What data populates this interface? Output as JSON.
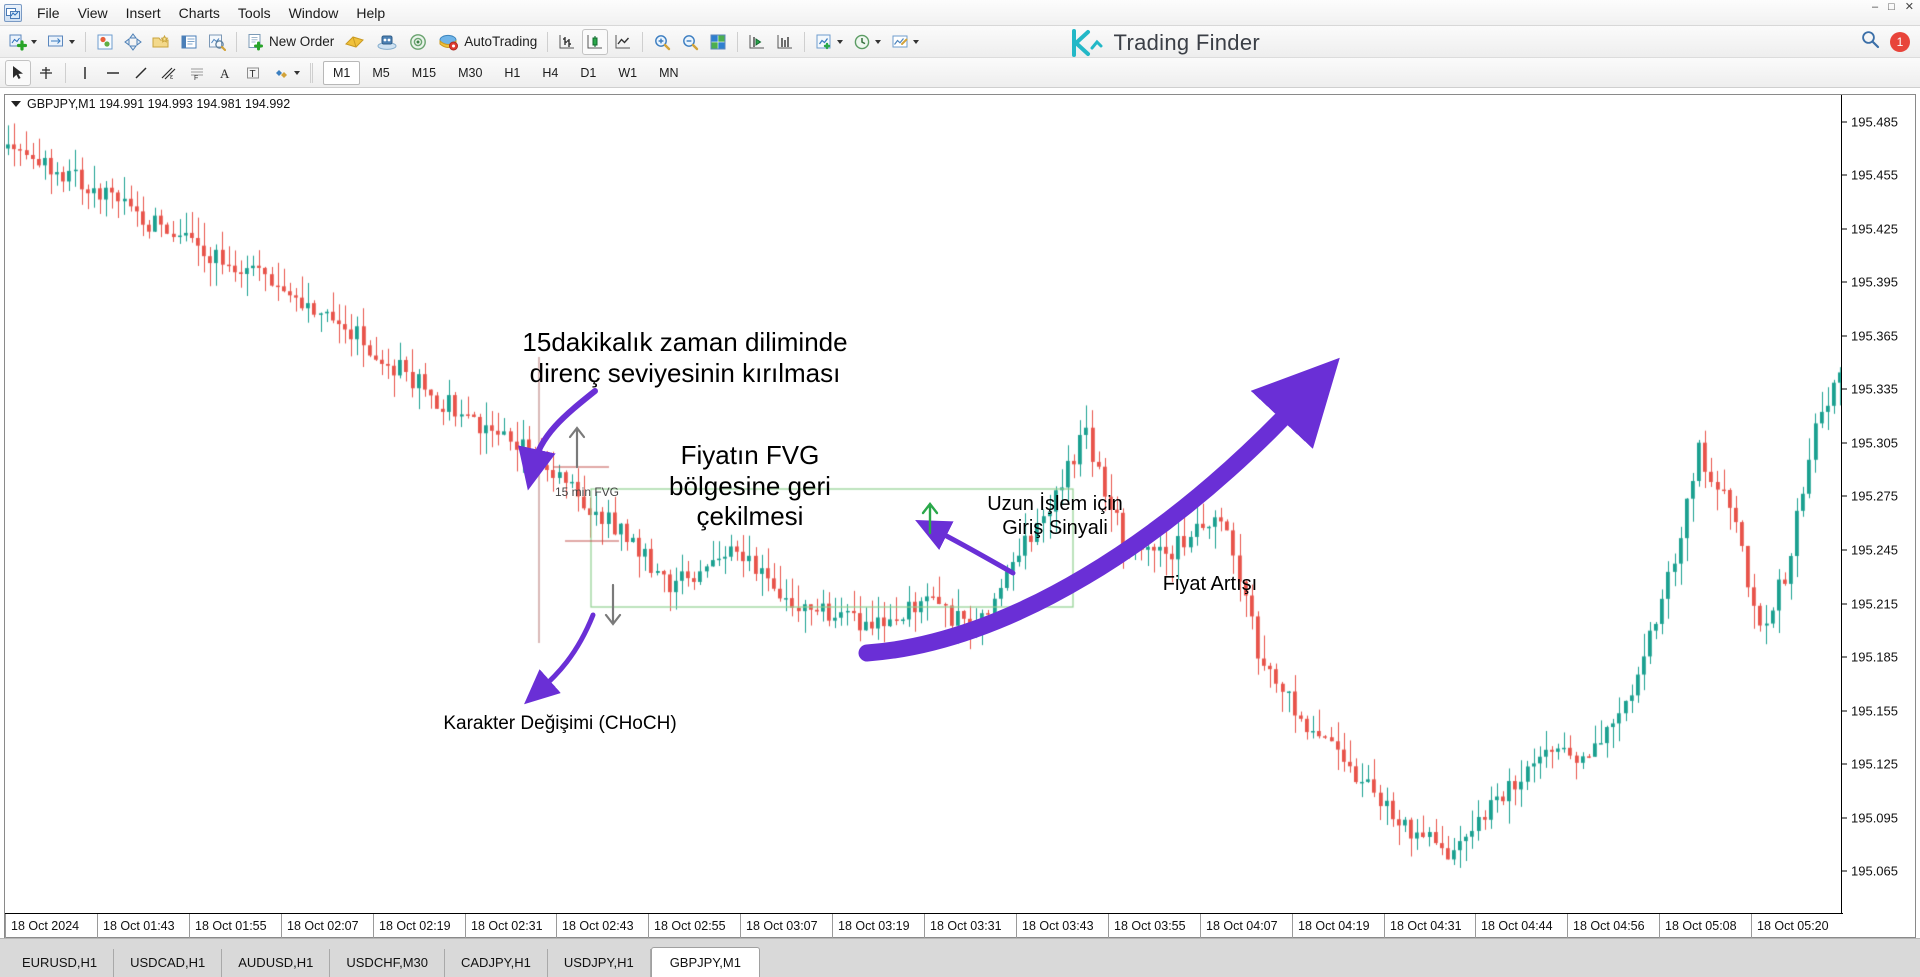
{
  "window": {
    "controls": [
      "minimize",
      "maximize",
      "close"
    ],
    "minimize_glyph": "–",
    "maximize_glyph": "□",
    "close_glyph": "✕"
  },
  "menu": {
    "app_icon": "metatrader-icon",
    "items": [
      "File",
      "View",
      "Insert",
      "Charts",
      "Tools",
      "Window",
      "Help"
    ]
  },
  "toolbar": {
    "new_chart_label": "",
    "new_order_label": "New Order",
    "autotrading_label": "AutoTrading",
    "icons": [
      "new-chart-icon",
      "profiles-icon",
      "indicators-icon",
      "crosshair-icon",
      "favorites-icon",
      "terminal-icon",
      "strategy-tester-icon",
      "new-order-icon",
      "metaeditor-icon",
      "expert-advisors-icon",
      "navigator-icon",
      "autotrading-icon",
      "bar-chart-icon",
      "candlestick-chart-icon",
      "line-chart-icon",
      "zoom-in-icon",
      "zoom-out-icon",
      "tile-windows-icon",
      "auto-scroll-icon",
      "chart-shift-icon",
      "indicators-list-icon",
      "periods-icon",
      "templates-icon"
    ],
    "brand_name": "Trading Finder",
    "brand_mark": "trading-finder-logo",
    "search_icon": "search-icon",
    "notification_count": "1"
  },
  "drawing_toolbar": {
    "icons": [
      "cursor-icon",
      "crosshair-icon",
      "vertical-line-icon",
      "horizontal-line-icon",
      "trendline-icon",
      "equidistant-channel-icon",
      "fibonacci-retracement-icon",
      "text-label-icon",
      "text-icon",
      "shapes-icon"
    ]
  },
  "timeframes": {
    "items": [
      "M1",
      "M5",
      "M15",
      "M30",
      "H1",
      "H4",
      "D1",
      "W1",
      "MN"
    ],
    "active": "M1"
  },
  "chart": {
    "symbol_line": "GBPJPY,M1   194.991 194.993 194.981 194.992",
    "symbol": "GBPJPY",
    "period": "M1",
    "ohlc": {
      "open": "194.991",
      "high": "194.993",
      "low": "194.981",
      "close": "194.992"
    },
    "fvg_label": "15 min FVG"
  },
  "chart_data": {
    "type": "line",
    "title": "GBPJPY,M1",
    "xlabel": "",
    "ylabel": "",
    "grid": false,
    "legend": "none",
    "ylim": [
      195.055,
      195.5
    ],
    "price_ticks": [
      "195.485",
      "195.455",
      "195.425",
      "195.395",
      "195.365",
      "195.335",
      "195.305",
      "195.275",
      "195.245",
      "195.215",
      "195.185",
      "195.155",
      "195.125",
      "195.095",
      "195.065"
    ],
    "price_tick_values": [
      195.485,
      195.455,
      195.425,
      195.395,
      195.365,
      195.335,
      195.305,
      195.275,
      195.245,
      195.215,
      195.185,
      195.155,
      195.125,
      195.095,
      195.065
    ],
    "time_ticks": [
      "18 Oct 2024",
      "18 Oct 01:43",
      "18 Oct 01:55",
      "18 Oct 02:07",
      "18 Oct 02:19",
      "18 Oct 02:31",
      "18 Oct 02:43",
      "18 Oct 02:55",
      "18 Oct 03:07",
      "18 Oct 03:19",
      "18 Oct 03:31",
      "18 Oct 03:43",
      "18 Oct 03:55",
      "18 Oct 04:07",
      "18 Oct 04:19",
      "18 Oct 04:31",
      "18 Oct 04:44",
      "18 Oct 04:56",
      "18 Oct 05:08",
      "18 Oct 05:20"
    ],
    "bull_color": "#1aa090",
    "bear_color": "#e8534a",
    "annotation_color": "#6a2fd6",
    "fvg_box_color": "#8fd18f"
  },
  "annotations": [
    {
      "name": "resistance-break-note",
      "text": "15dakikalık zaman diliminde\ndirenç seviyesinin kırılması"
    },
    {
      "name": "fvg-retrace-note",
      "text": "Fiyatın FVG\nbölgesine geri\nçekilmesi"
    },
    {
      "name": "entry-signal-note",
      "text": "Uzun İşlem için\nGiriş Sinyali"
    },
    {
      "name": "price-increase-note",
      "text": "Fiyat Artışı"
    },
    {
      "name": "choch-note",
      "text": "Karakter Değişimi (CHoCH)"
    }
  ],
  "tabs": {
    "items": [
      "EURUSD,H1",
      "USDCAD,H1",
      "AUDUSD,H1",
      "USDCHF,M30",
      "CADJPY,H1",
      "USDJPY,H1",
      "GBPJPY,M1"
    ],
    "active": "GBPJPY,M1"
  }
}
